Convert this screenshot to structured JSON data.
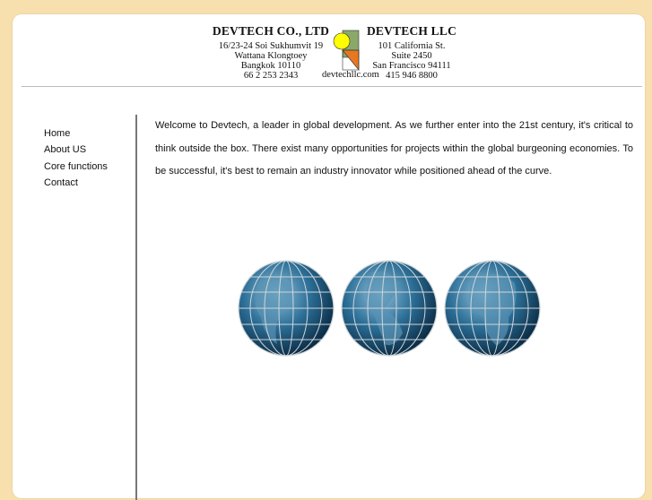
{
  "header": {
    "left_company": {
      "name": "DEVTECH CO., LTD",
      "address_lines": [
        "16/23-24 Soi Sukhumvit 19",
        "Wattana Klongtoey",
        "Bangkok 10110",
        "66 2 253 2343"
      ]
    },
    "right_company": {
      "name": "DEVTECH LLC",
      "address_lines": [
        "101 California St.",
        "Suite 2450",
        "San Francisco 94111",
        "415 946 8800"
      ]
    },
    "website": "devtechllc.com",
    "logo_colors": {
      "circle": "#ffff00",
      "square": "#8aa86a",
      "triangle": "#e87722"
    }
  },
  "nav": {
    "items": [
      {
        "label": "Home"
      },
      {
        "label": "About US"
      },
      {
        "label": "Core functions"
      },
      {
        "label": "Contact"
      }
    ]
  },
  "content": {
    "welcome_text": "Welcome to Devtech, a leader in global development. As we further enter into the 21st century, it's critical to think outside the box. There exist many opportunities for projects within the global burgeoning economies. To be successful, it's best to remain an industry innovator while positioned ahead of the curve."
  },
  "colors": {
    "background": "#f7dfae",
    "page": "#ffffff",
    "globe": "#1f5f86",
    "grid": "#c9d1d6"
  }
}
